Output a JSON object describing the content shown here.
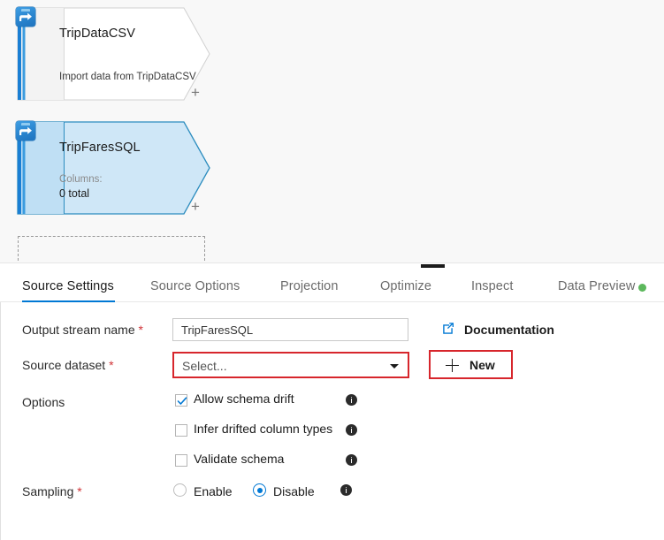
{
  "canvas": {
    "nodes": [
      {
        "id": "node-tripdatacsv",
        "title": "TripDataCSV",
        "subtitle": "Import data from TripDataCSV",
        "sublabel": "",
        "icon": "source-import-icon",
        "selected": false,
        "add_label": "+"
      },
      {
        "id": "node-tripfaressql",
        "title": "TripFaresSQL",
        "subtitle": "0 total",
        "sublabel": "Columns:",
        "icon": "source-import-icon",
        "selected": true,
        "add_label": "+"
      }
    ],
    "dropzone_name": "empty-transformation-dropzone"
  },
  "splitter": {
    "handle_name": "panel-resize-handle"
  },
  "tabs": [
    {
      "label": "Source Settings",
      "active": true,
      "dot": null
    },
    {
      "label": "Source Options",
      "active": false,
      "dot": null
    },
    {
      "label": "Projection",
      "active": false,
      "dot": null
    },
    {
      "label": "Optimize",
      "active": false,
      "dot": null
    },
    {
      "label": "Inspect",
      "active": false,
      "dot": null
    },
    {
      "label": "Data Preview",
      "active": false,
      "dot": "#5cb85c"
    }
  ],
  "form": {
    "output_stream": {
      "label": "Output stream name",
      "required": "*",
      "value": "TripFaresSQL",
      "placeholder": ""
    },
    "source_dataset": {
      "label": "Source dataset",
      "required": "*",
      "value": "Select...",
      "error_color": "#d7262c"
    },
    "documentation": {
      "label": "Documentation",
      "icon": "external-link-icon"
    },
    "new_button": {
      "label": "New",
      "icon": "plus-icon",
      "highlight_color": "#d7262c"
    },
    "options": {
      "label": "Options",
      "items": [
        {
          "label": "Allow schema drift",
          "checked": true
        },
        {
          "label": "Infer drifted column types",
          "checked": false
        },
        {
          "label": "Validate schema",
          "checked": false
        }
      ]
    },
    "sampling": {
      "label": "Sampling",
      "required": "*",
      "options": [
        {
          "label": "Enable",
          "selected": false
        },
        {
          "label": "Disable",
          "selected": true
        }
      ]
    }
  },
  "colors": {
    "accent": "#0078d4",
    "error": "#d7262c",
    "node_stroke": "#2b8cbe",
    "node_fill_selected": "#cfe7f7",
    "status_ok": "#5cb85c"
  }
}
